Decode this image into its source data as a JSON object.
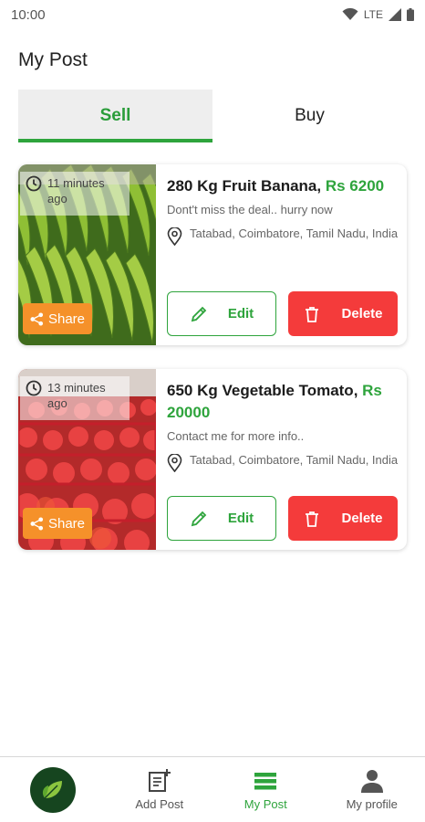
{
  "status_bar": {
    "time": "10:00",
    "network": "LTE"
  },
  "page": {
    "title": "My Post"
  },
  "tabs": [
    {
      "label": "Sell"
    },
    {
      "label": "Buy"
    }
  ],
  "posts": [
    {
      "time_ago": "11 minutes ago",
      "title": "280 Kg Fruit Banana, ",
      "price": "Rs 6200",
      "description": "Dont't miss the deal.. hurry now",
      "location": "Tatabad, Coimbatore, Tamil Nadu, India",
      "share_label": "Share",
      "edit_label": "Edit",
      "delete_label": "Delete"
    },
    {
      "time_ago": "13 minutes ago",
      "title": "650 Kg Vegetable Tomato, ",
      "price": "Rs 20000",
      "description": "Contact me for more info..",
      "location": "Tatabad, Coimbatore, Tamil Nadu, India",
      "share_label": "Share",
      "edit_label": "Edit",
      "delete_label": "Delete"
    }
  ],
  "bottom_nav": [
    {
      "label": "",
      "icon": "leaf-logo-icon"
    },
    {
      "label": "Add Post",
      "icon": "add-post-icon"
    },
    {
      "label": "My Post",
      "icon": "list-icon"
    },
    {
      "label": "My profile",
      "icon": "person-icon"
    }
  ],
  "colors": {
    "accent": "#2ea43c",
    "share": "#f5912a",
    "delete": "#f43b3b",
    "logo_bg": "#16451f"
  }
}
